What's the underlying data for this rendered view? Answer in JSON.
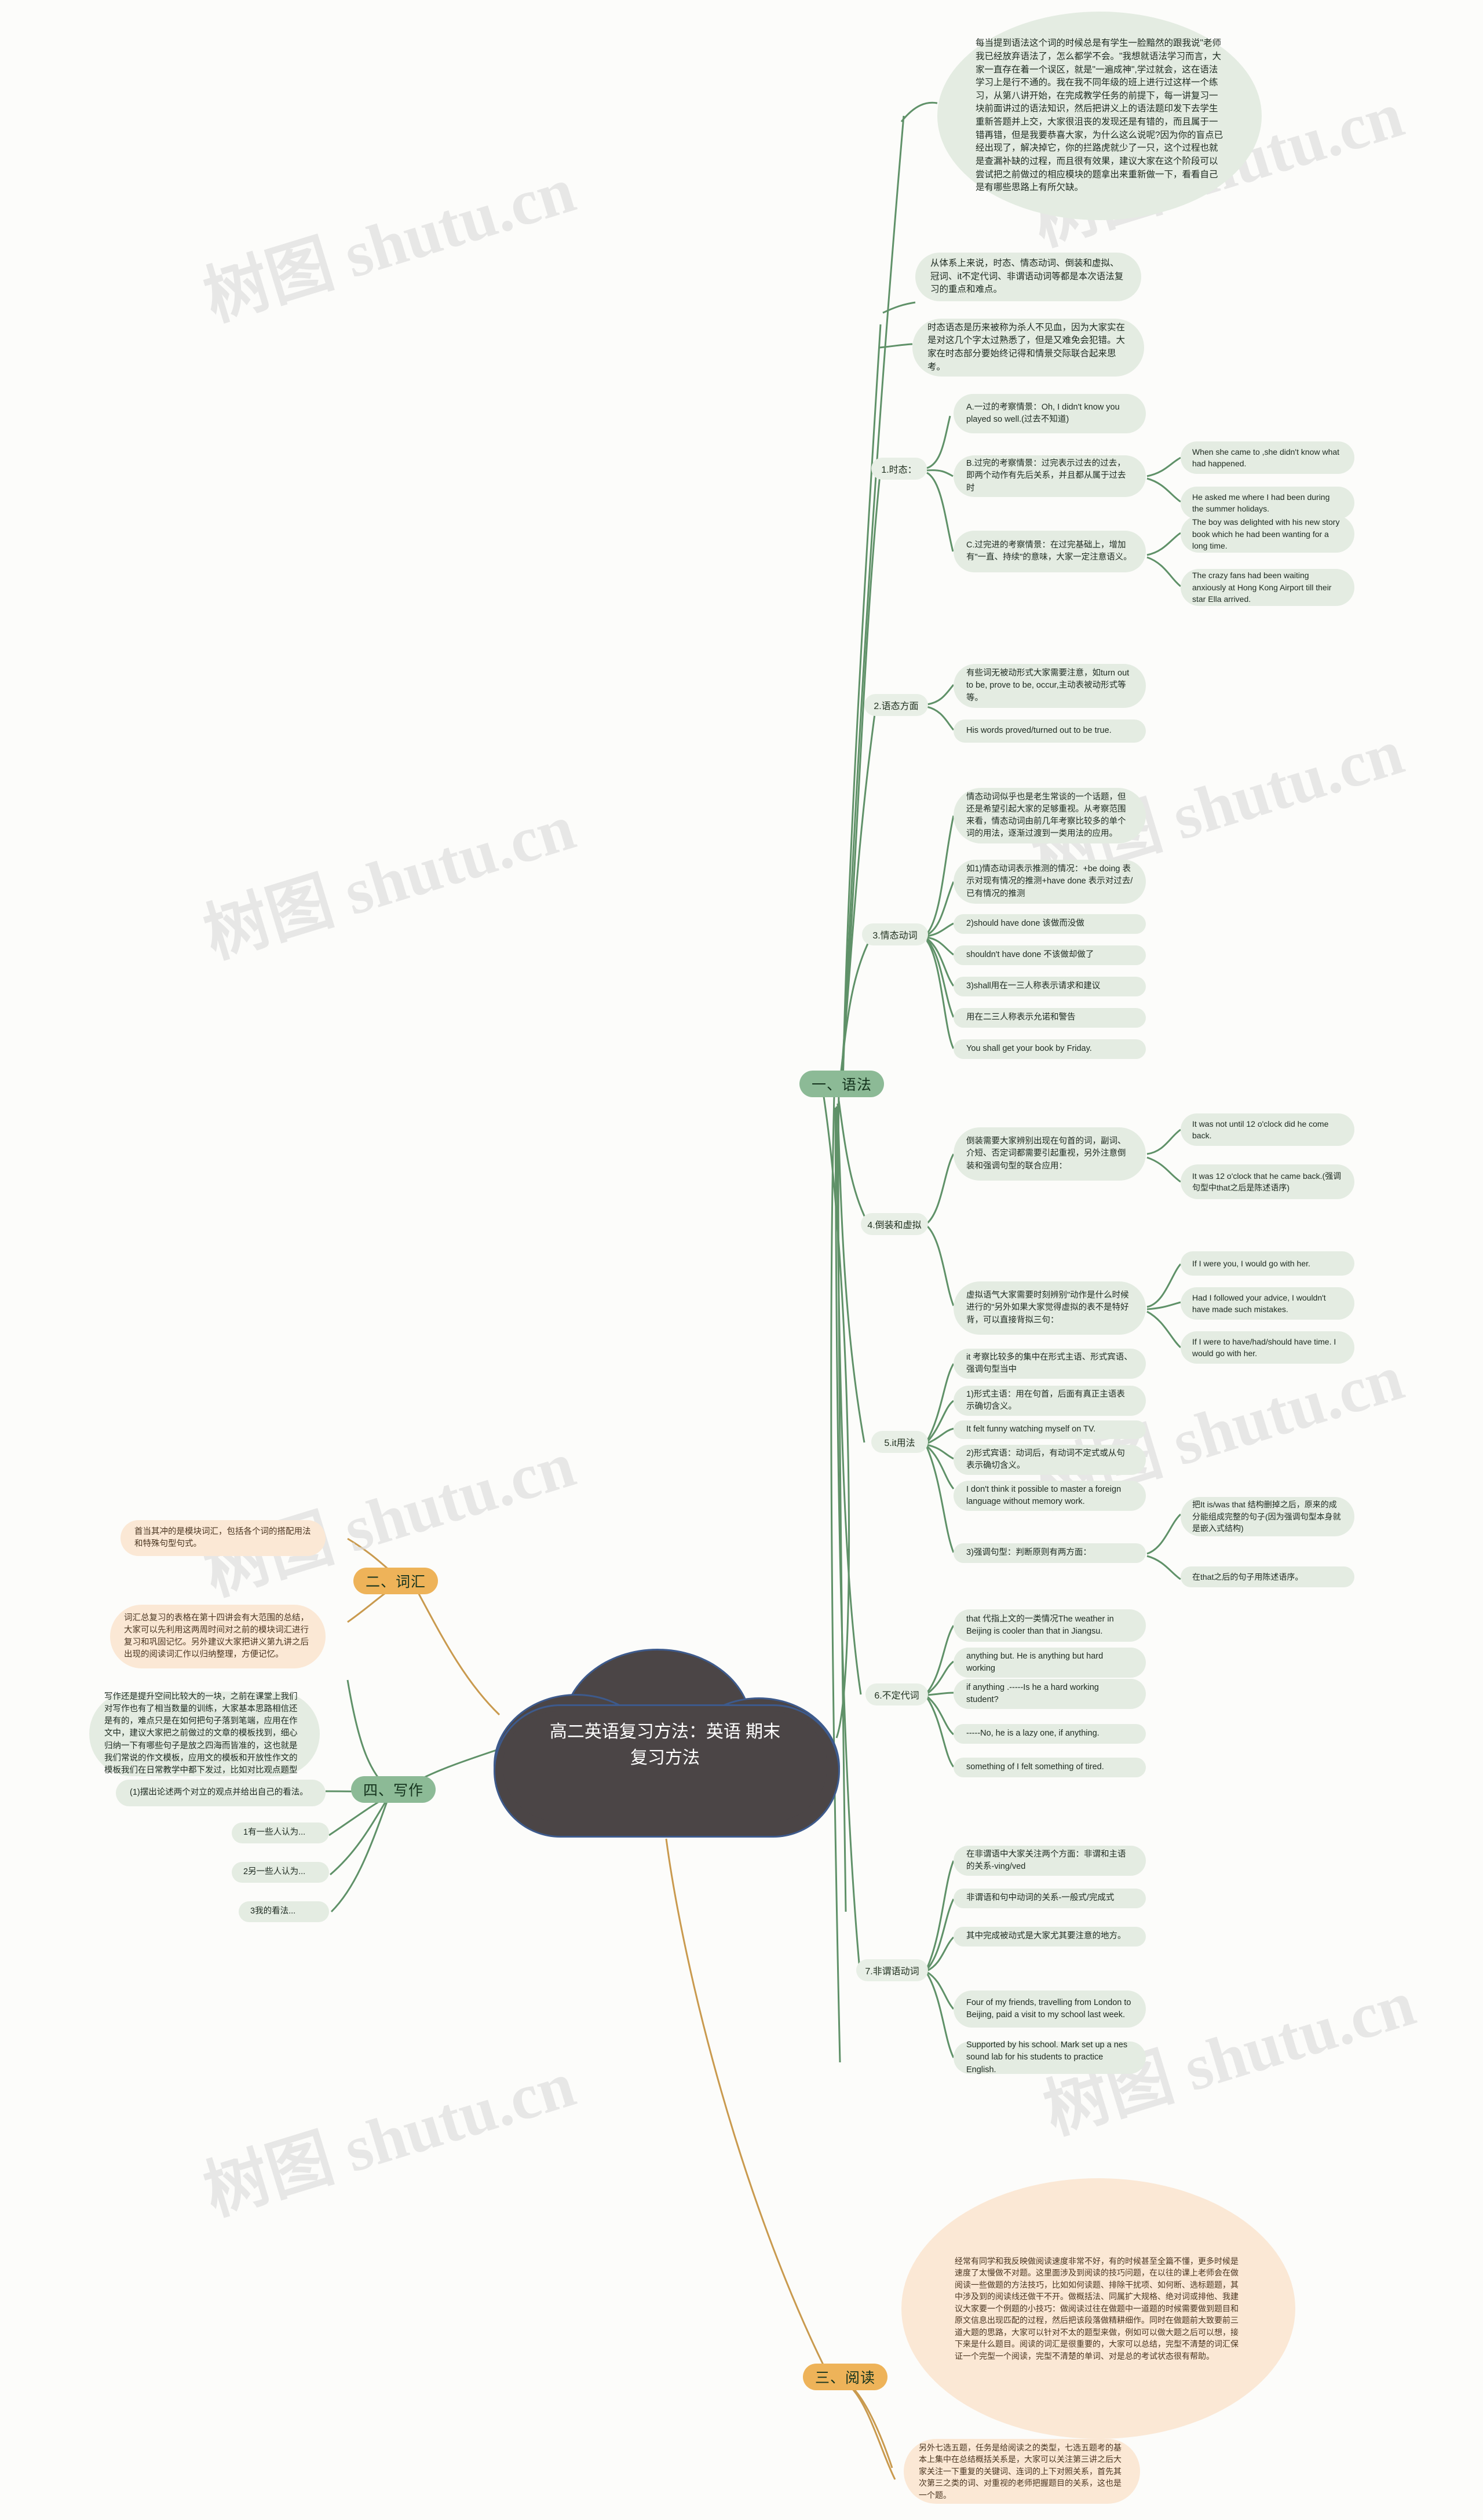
{
  "title": "高二英语复习方法：英语\n期末复习方法",
  "watermark": "树图 shutu.cn",
  "colors": {
    "branch_green": "#8cba96",
    "branch_orange": "#eeb359",
    "node_green": "#e4ece2",
    "node_orange": "#fbe8d5",
    "center": "#4b4546",
    "center_border": "#3d5a8c",
    "link_green": "#5f9168",
    "link_orange": "#c99a4e"
  },
  "branches": [
    {
      "id": "grammar",
      "label": "一、语法",
      "color": "green"
    },
    {
      "id": "vocab",
      "label": "二、词汇",
      "color": "orange"
    },
    {
      "id": "reading",
      "label": "三、阅读",
      "color": "orange"
    },
    {
      "id": "writing",
      "label": "四、写作",
      "color": "green"
    }
  ],
  "grammar": {
    "intro": "每当提到语法这个词的时候总是有学生一脸黯然的跟我说\"老师我已经放弃语法了，怎么都学不会。\"我想就语法学习而言，大家一直存在着一个误区，就是\"一遍成神\",学过就会，这在语法学习上是行不通的。我在我不同年级的班上进行过这样一个练习，从第八讲开始，在完成教学任务的前提下，每一讲复习一块前面讲过的语法知识，然后把讲义上的语法题印发下去学生重新答题并上交，大家很沮丧的发现还是有错的，而且属于一错再错，但是我要恭喜大家，为什么这么说呢?因为你的盲点已经出现了，解决掉它，你的拦路虎就少了一只，这个过程也就是查漏补缺的过程，而且很有效果，建议大家在这个阶段可以尝试把之前做过的相应模块的题拿出来重新做一下，看看自己是有哪些思路上有所欠缺。",
    "note1": "从体系上来说，时态、情态动词、倒装和虚拟、冠词、it不定代词、非谓语动词等都是本次语法复习的重点和难点。",
    "note2": "时态语态是历来被称为杀人不见血，因为大家实在是对这几个字太过熟悉了，但是又难免会犯错。大家在时态部分要始终记得和情景交际联合起来思考。",
    "sections": [
      {
        "label": "1.时态：",
        "children": [
          {
            "text": "A.一过的考察情景：Oh, I didn't know you played so well.(过去不知道)",
            "leaves": []
          },
          {
            "text": "B.过完的考察情景：过完表示过去的过去，即两个动作有先后关系，并且都从属于过去时",
            "leaves": [
              "When she came to ,she didn't know what had happened.",
              "He asked me where I had been during the summer holidays."
            ]
          },
          {
            "text": "C.过完进的考察情景：在过完基础上，增加有\"一直、持续\"的意味，大家一定注意语义。",
            "leaves": [
              "The boy was delighted with his new story book which he had been wanting for a long time.",
              "The crazy fans had been waiting anxiously at Hong Kong Airport till their star Ella arrived."
            ]
          }
        ]
      },
      {
        "label": "2.语态方面",
        "children": [
          {
            "text": "有些词无被动形式大家需要注意，如turn out to be, prove to be, occur,主动表被动形式等等。",
            "leaves": []
          },
          {
            "text": "His words proved/turned out to be true.",
            "leaves": []
          }
        ]
      },
      {
        "label": "3.情态动词",
        "children": [
          {
            "text": "情态动词似乎也是老生常谈的一个话题，但还是希望引起大家的足够重视。从考察范围来看，情态动词由前几年考察比较多的单个词的用法，逐渐过渡到一类用法的应用。",
            "leaves": []
          },
          {
            "text": "如1)情态动词表示推测的情况：+be doing 表示对现有情况的推测+have done 表示对过去/已有情况的推测",
            "leaves": []
          },
          {
            "text": "2)should have done 该做而没做",
            "leaves": []
          },
          {
            "text": "shouldn't have done 不该做却做了",
            "leaves": []
          },
          {
            "text": "3)shall用在一三人称表示请求和建议",
            "leaves": []
          },
          {
            "text": "用在二三人称表示允诺和警告",
            "leaves": []
          },
          {
            "text": "You shall get your book by Friday.",
            "leaves": []
          }
        ]
      },
      {
        "label": "4.倒装和虚拟",
        "children": [
          {
            "text": "倒装需要大家辨别出现在句首的词，副词、介短、否定词都需要引起重视，另外注意倒装和强调句型的联合应用：",
            "leaves": [
              "It was not until 12 o'clock did he come back.",
              "It was 12 o'clock that he came back.(强调句型中that之后是陈述语序)"
            ]
          },
          {
            "text": "虚拟语气大家需要时刻辨别\"动作是什么时候进行的\"另外如果大家觉得虚拟的表不是特好背，可以直接背拟三句：",
            "leaves": [
              "If I were you, I would go with her.",
              "Had I followed your advice, I wouldn't have made such mistakes.",
              "If I were to have/had/should have time. I would go with her."
            ]
          }
        ]
      },
      {
        "label": "5.it用法",
        "children": [
          {
            "text": "it 考察比较多的集中在形式主语、形式宾语、强调句型当中",
            "leaves": []
          },
          {
            "text": "1)形式主语：用在句首，后面有真正主语表示确切含义。",
            "leaves": []
          },
          {
            "text": "It felt funny watching myself on TV.",
            "leaves": []
          },
          {
            "text": "2)形式宾语：动词后，有动词不定式或从句表示确切含义。",
            "leaves": []
          },
          {
            "text": "I don't think it possible to master a foreign language without memory work.",
            "leaves": []
          },
          {
            "text": "3)强调句型：判断原则有两方面：",
            "leaves": [
              "把It is/was that 结构删掉之后，原来的成分能组成完整的句子(因为强调句型本身就是嵌入式结构)",
              "在that之后的句子用陈述语序。"
            ]
          }
        ]
      },
      {
        "label": "6.不定代词",
        "children": [
          {
            "text": "that 代指上文的一类情况The weather in Beijing is cooler than that in Jiangsu.",
            "leaves": []
          },
          {
            "text": "anything but. He is anything but hard working",
            "leaves": []
          },
          {
            "text": "if anything .-----Is he a hard working student?",
            "leaves": []
          },
          {
            "text": "-----No, he is a lazy one, if anything.",
            "leaves": []
          },
          {
            "text": "something of I felt something of tired.",
            "leaves": []
          }
        ]
      },
      {
        "label": "7.非谓语动词",
        "children": [
          {
            "text": "在非谓语中大家关注两个方面：非谓和主语的关系-ving/ved",
            "leaves": []
          },
          {
            "text": "非谓语和句中动词的关系-一般式/完成式",
            "leaves": []
          },
          {
            "text": "其中完成被动式是大家尤其要注意的地方。",
            "leaves": []
          },
          {
            "text": "Four of my friends, travelling from London to Beijing, paid a visit to my school last week.",
            "leaves": []
          },
          {
            "text": "Supported by his school. Mark set up a nes sound lab for his students to practice English.",
            "leaves": []
          }
        ]
      }
    ]
  },
  "vocab": {
    "items": [
      "首当其冲的是模块词汇，包括各个词的搭配用法和特殊句型句式。",
      "词汇总复习的表格在第十四讲会有大范围的总结，大家可以先利用这两周时间对之前的模块词汇进行复习和巩固记忆。另外建议大家把讲义第九讲之后出现的阅读词汇作以归纳整理，方便记忆。"
    ]
  },
  "writing": {
    "intro": "写作还是提升空间比较大的一块，之前在课堂上我们对写作也有了相当数量的训练，大家基本思路相信还是有的，难点只是在如何把句子落到笔端，应用在作文中，建议大家把之前做过的文章的模板找到，细心归纳一下有哪些句子是放之四海而皆准的，这也就是我们常说的作文模板，应用文的模板和开放性作文的模板我们在日常教学中都下发过，比如对比观点题型",
    "items": [
      "(1)摆出论述两个对立的观点并给出自己的看法。",
      "1有一些人认为...",
      "2另一些人认为...",
      "3我的看法..."
    ]
  },
  "reading": {
    "items": [
      "经常有同学和我反映做阅读速度非常不好，有的时候甚至全篇不懂，更多时候是速度了太慢做不对题。这里面涉及到阅读的技巧问题，在以往的课上老师会在做阅读一些做题的方法技巧，比如如何读题、排除干扰项、如何断、选标题题，其中涉及到的阅读线还做干不开。做概括法、同属扩大规格、绝对词或排他、我建议大家要一个例题的小技巧：做阅读过往在做题中一道题的时候需要做到题目和原文信息出现匹配的过程，然后把该段落做精耕细作。同时在做题前大致要前三道大题的思路，大家可以针对不太的题型来做，例如可以做大题之后可以想，接下来是什么题目。阅读的词汇是很重要的，大家可以总结，完型不清楚的词汇保证一个完型一个阅读，完型不清楚的单词、对是总的考试状态很有帮助。",
      "另外七选五题，任务是给阅读之的类型，七选五题考的基本上集中在总结概括关系是，大家可以关注第三讲之后大家关注一下重复的关键词、连词的上下对照关系，首先其次第三之类的词、对重视的老师把握题目的关系，这也是一个题。"
    ]
  }
}
